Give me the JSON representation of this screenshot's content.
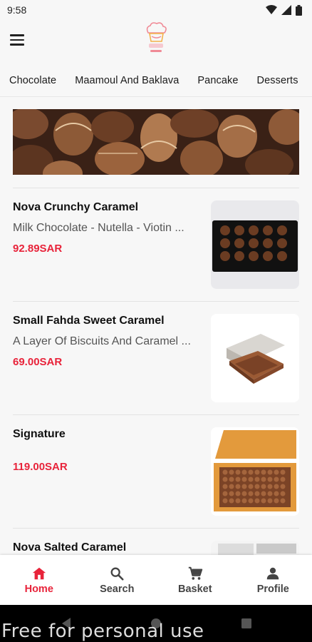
{
  "status_bar": {
    "time": "9:58"
  },
  "tabs": [
    {
      "label": "Chocolate",
      "active": true
    },
    {
      "label": "Maamoul And Baklava",
      "active": false
    },
    {
      "label": "Pancake",
      "active": false
    },
    {
      "label": "Desserts",
      "active": false
    }
  ],
  "products": [
    {
      "name": "Nova Crunchy Caramel",
      "description": "Milk Chocolate - Nutella - Viotin ...",
      "price": "92.89SAR"
    },
    {
      "name": "Small Fahda Sweet Caramel",
      "description": "A Layer Of Biscuits And Caramel ...",
      "price": "69.00SAR"
    },
    {
      "name": "Signature",
      "description": "",
      "price": "119.00SAR"
    },
    {
      "name": "Nova Salted Caramel",
      "description": "",
      "price": ""
    }
  ],
  "bottom_nav": {
    "home": "Home",
    "search": "Search",
    "basket": "Basket",
    "profile": "Profile"
  },
  "watermark": "Free for personal use",
  "colors": {
    "accent": "#e8233a",
    "tab_indicator": "#e8474b"
  },
  "icons": [
    "menu-icon",
    "wifi-icon",
    "signal-icon",
    "battery-icon",
    "home-icon",
    "search-icon",
    "cart-icon",
    "person-icon"
  ]
}
